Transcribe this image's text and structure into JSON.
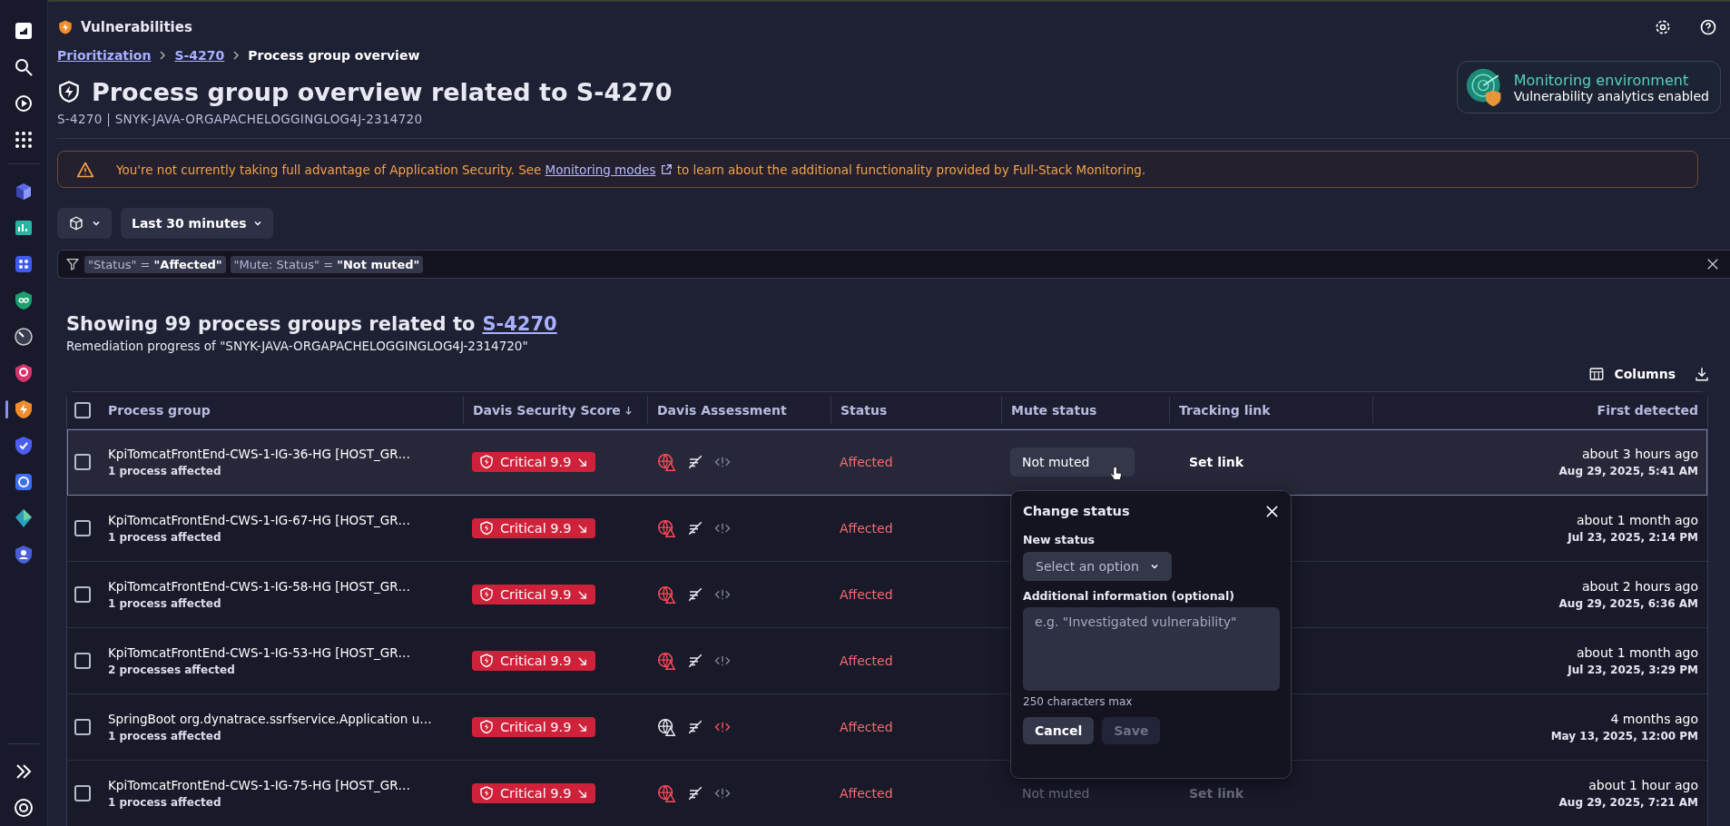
{
  "sidebar": {
    "items": [
      {
        "kind": "logo",
        "selected": false
      },
      {
        "kind": "search",
        "selected": false
      },
      {
        "kind": "play",
        "selected": false
      },
      {
        "kind": "grid",
        "selected": false
      },
      {
        "kind": "cube",
        "selected": false
      },
      {
        "kind": "chart",
        "selected": false
      },
      {
        "kind": "puzzle",
        "selected": false
      },
      {
        "kind": "infinity",
        "selected": false
      },
      {
        "kind": "gauge",
        "selected": false
      },
      {
        "kind": "magnifier-shield",
        "selected": false
      },
      {
        "kind": "bolt-shield",
        "selected": true
      },
      {
        "kind": "check-shield",
        "selected": false
      },
      {
        "kind": "helm",
        "selected": false
      },
      {
        "kind": "gem",
        "selected": false
      },
      {
        "kind": "person-shield",
        "selected": false
      }
    ],
    "bottom": [
      {
        "kind": "expand"
      },
      {
        "kind": "help"
      }
    ]
  },
  "app": {
    "title": "Vulnerabilities"
  },
  "breadcrumb": [
    {
      "label": "Prioritization",
      "kind": "link"
    },
    {
      "label": "S-4270",
      "kind": "link"
    },
    {
      "label": "Process group overview",
      "kind": "current"
    }
  ],
  "page": {
    "title": "Process group overview related to S-4270",
    "subtitle": "S-4270 | SNYK-JAVA-ORGAPACHELOGGINGLOG4J-2314720"
  },
  "environment": {
    "title": "Monitoring environment",
    "subtitle": "Vulnerability analytics enabled"
  },
  "banner": {
    "before": "You're not currently taking full advantage of Application Security. See",
    "link": "Monitoring modes",
    "after": "to learn about the additional functionality provided by Full-Stack Monitoring."
  },
  "toolbar": {
    "timeframe": "Last 30 minutes"
  },
  "filters": [
    "\"Status\" = **\"Affected\"**",
    "\"Mute: Status\" = **\"Not muted\"**"
  ],
  "summary": {
    "heading": "Showing 99 process groups related to",
    "heading_link": "S-4270",
    "subtitle": "Remediation progress of \"SNYK-JAVA-ORGAPACHELOGGINGLOG4J-2314720\""
  },
  "table_actions": {
    "columns": "Columns"
  },
  "table": {
    "header_checked": false,
    "columns": [
      {
        "label": "Process group",
        "sorted": false
      },
      {
        "label": "Davis Security Score",
        "sorted": true
      },
      {
        "label": "Davis Assessment",
        "sorted": false
      },
      {
        "label": "Status",
        "sorted": false
      },
      {
        "label": "Mute status",
        "sorted": false
      },
      {
        "label": "Tracking link",
        "sorted": false
      },
      {
        "label": "First detected",
        "sorted": false
      }
    ],
    "rows": [
      {
        "checked": false,
        "highlighted": true,
        "name": "KpiTomcatFrontEnd-CWS-1-IG-36-HG [HOST_GR…",
        "processes": "1 process affected",
        "score": "Critical 9.9",
        "exposed": true,
        "exploit": false,
        "status": "Affected",
        "mute": "Not muted",
        "link": "Set link",
        "ago": "about 3 hours ago",
        "date": "Aug 29, 2025, 5:41 AM"
      },
      {
        "checked": false,
        "highlighted": false,
        "name": "KpiTomcatFrontEnd-CWS-1-IG-67-HG [HOST_GR…",
        "processes": "1 process affected",
        "score": "Critical 9.9",
        "exposed": true,
        "exploit": false,
        "status": "Affected",
        "ago": "about 1 month ago",
        "date": "Jul 23, 2025, 2:14 PM"
      },
      {
        "checked": false,
        "highlighted": false,
        "name": "KpiTomcatFrontEnd-CWS-1-IG-58-HG [HOST_GR…",
        "processes": "1 process affected",
        "score": "Critical 9.9",
        "exposed": true,
        "exploit": false,
        "status": "Affected",
        "ago": "about 2 hours ago",
        "date": "Aug 29, 2025, 6:36 AM"
      },
      {
        "checked": false,
        "highlighted": false,
        "name": "KpiTomcatFrontEnd-CWS-1-IG-53-HG [HOST_GR…",
        "processes": "2 processes affected",
        "score": "Critical 9.9",
        "exposed": true,
        "exploit": false,
        "status": "Affected",
        "ago": "about 1 month ago",
        "date": "Jul 23, 2025, 3:29 PM"
      },
      {
        "checked": false,
        "highlighted": false,
        "name": "SpringBoot org.dynatrace.ssrfservice.Application u…",
        "processes": "1 process affected",
        "score": "Critical 9.9",
        "exposed": false,
        "exploit": true,
        "status": "Affected",
        "ago": "4 months ago",
        "date": "May 13, 2025, 12:00 PM"
      },
      {
        "checked": false,
        "highlighted": false,
        "name": "KpiTomcatFrontEnd-CWS-1-IG-75-HG [HOST_GR…",
        "processes": "1 process affected",
        "score": "Critical 9.9",
        "exposed": true,
        "exploit": false,
        "status": "Affected",
        "mute": "Not muted",
        "link": "Set link",
        "ago": "about 1 hour ago",
        "date": "Aug 29, 2025, 7:21 AM"
      }
    ]
  },
  "popup": {
    "title": "Change status",
    "status_label": "New status",
    "select_placeholder": "Select an option",
    "info_label": "Additional information (optional)",
    "info_placeholder": "e.g. \"Investigated vulnerability\"",
    "hint": "250 characters max",
    "cancel": "Cancel",
    "save": "Save",
    "save_disabled": true
  }
}
